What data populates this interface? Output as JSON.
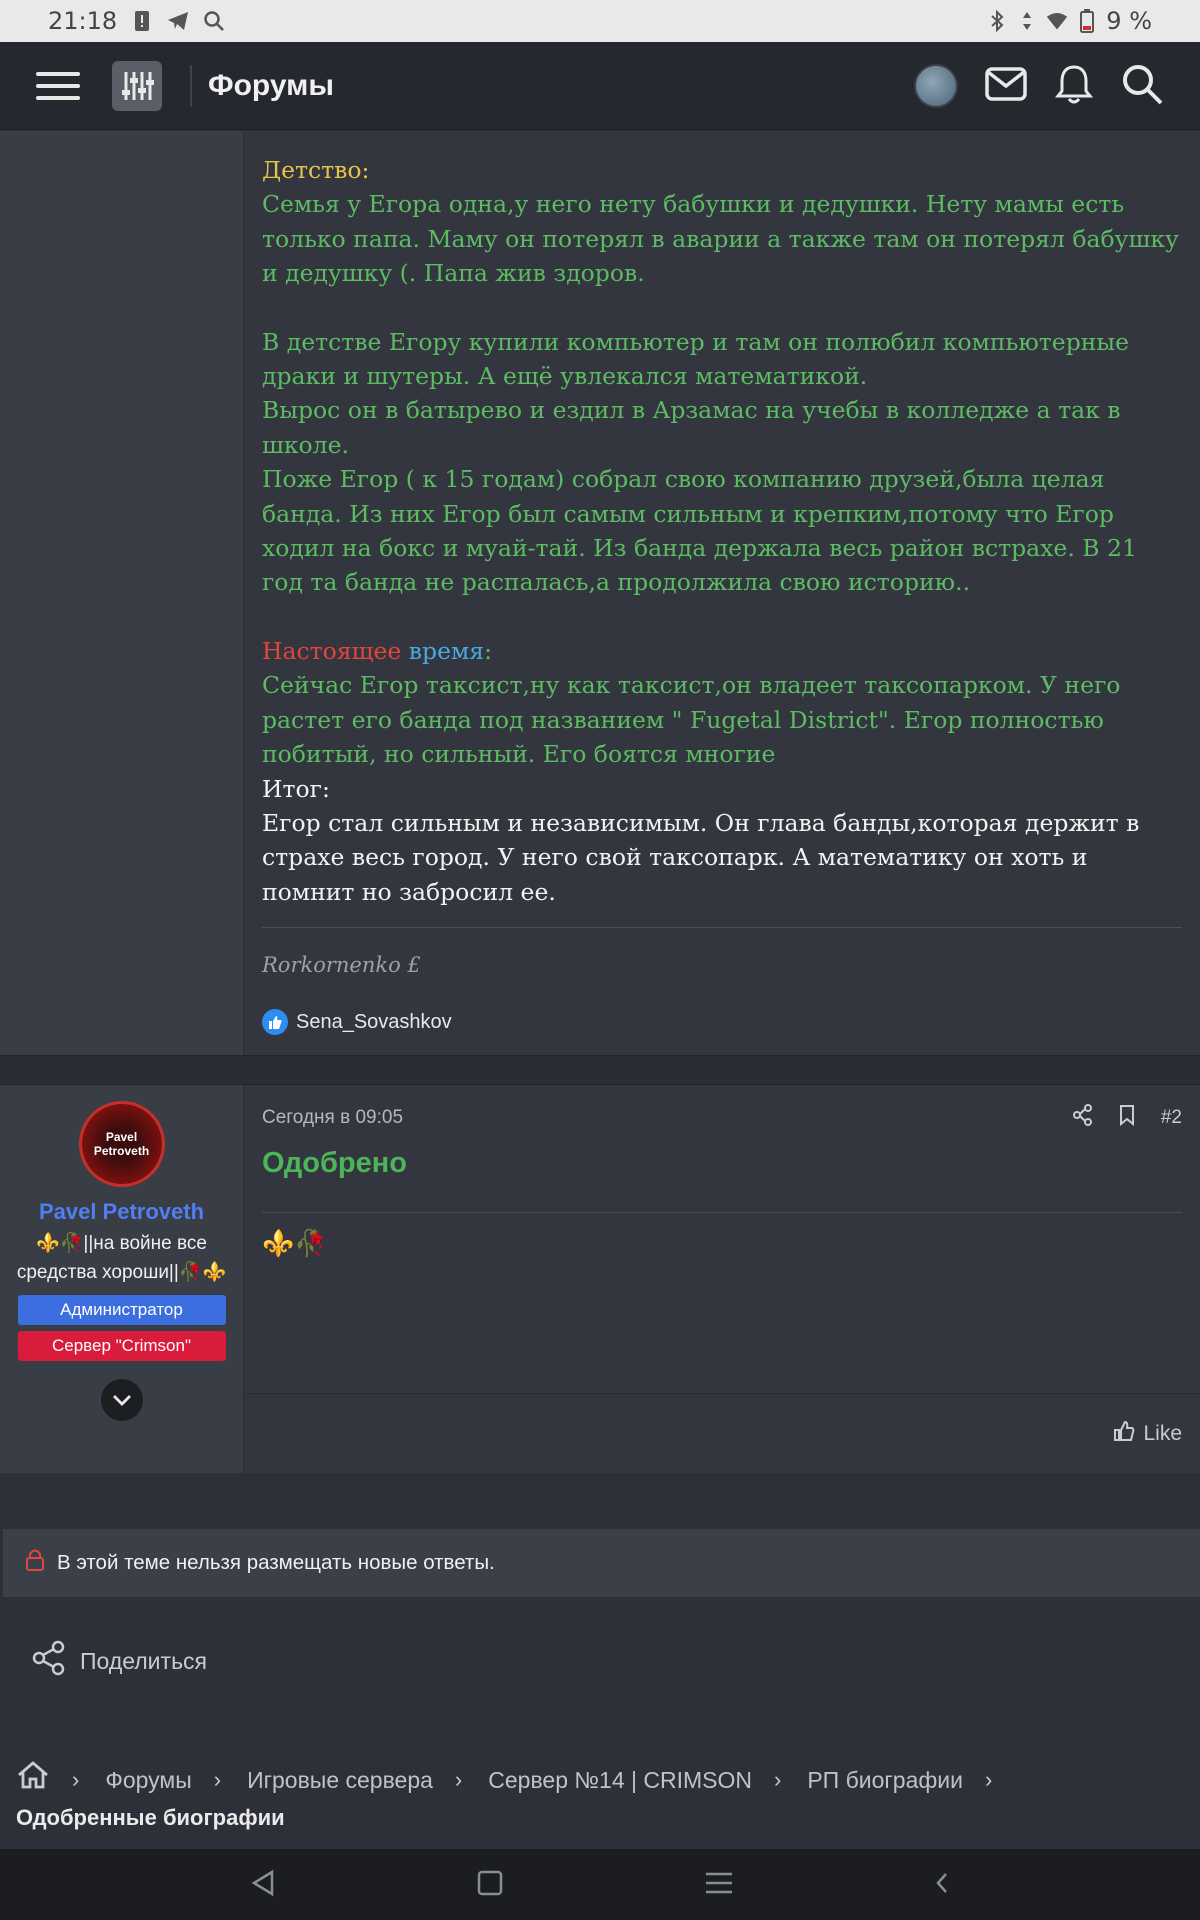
{
  "status_bar": {
    "time": "21:18",
    "battery": "9 %"
  },
  "app_bar": {
    "title": "Форумы",
    "icons": [
      "menu-icon",
      "preferences-icon",
      "avatar",
      "envelope-icon",
      "bell-icon",
      "search-icon"
    ]
  },
  "post1": {
    "heading": "Детство:",
    "p1": "Семья у Егора одна,у него нету бабушки и дедушки. Нету мамы есть только папа. Маму он потерял в аварии а также там он потерял бабушку и дедушку (. Папа жив здоров.",
    "p2_l1": "В детстве Егору купили компьютер и там он полюбил компьютерные драки и шутеры. А ещё увлекался математикой.",
    "p2_l2": "Вырос он в батырево и ездил в Арзамас на учебы в колледже а так в школе.",
    "p2_l3": "Поже Егор ( к 15 годам) собрал свою компанию друзей,была целая банда. Из них Егор был самым сильным и крепким,потому что Егор ходил на бокс и муай-тай. Из банда держала весь район встрахе. В 21 год та банда не распалась,а продолжила свою историю..",
    "present_word1": "Настоящее",
    "present_word2": "время",
    "present_colon": ":",
    "p3": "Сейчас Егор таксист,ну как таксист,он владеет таксопарком. У него растет его банда под названием \" Fugetal District\". Егор полностью побитый, но сильный. Его боятся многие",
    "summary_heading": "Итог:",
    "summary": "Егор стал сильным и независимым. Он глава банды,которая держит в страхе весь город. У него свой таксопарк. А математику он хоть и помнит но забросил ее.",
    "signature": "Rorkornenko £",
    "liked_by": "Sena_Sovashkov"
  },
  "post2": {
    "avatar_text": "Pavel Petroveth",
    "username": "Pavel Petroveth",
    "user_title": "⚜️🥀||на войне все средства хороши||🥀⚜️",
    "banner_admin": "Администратор",
    "banner_server": "Сервер \"Crimson\"",
    "date": "Сегодня в 09:05",
    "post_number": "#2",
    "approved": "Одобрено",
    "emoji": "⚜️🥀",
    "like_label": "Like"
  },
  "notice": "В этой теме нельзя размещать новые ответы.",
  "share_label": "Поделиться",
  "breadcrumb": {
    "items": [
      "Форумы",
      "Игровые сервера",
      "Сервер №14 | CRIMSON",
      "РП биографии"
    ],
    "current": "Одобренные биографии"
  },
  "colors": {
    "accent_green": "#5dbb63",
    "heading_yellow": "#e6c34c",
    "red": "#e2453c",
    "blue": "#4aa8de",
    "admin_blue": "#3d6ee0",
    "server_red": "#d91c3c"
  }
}
